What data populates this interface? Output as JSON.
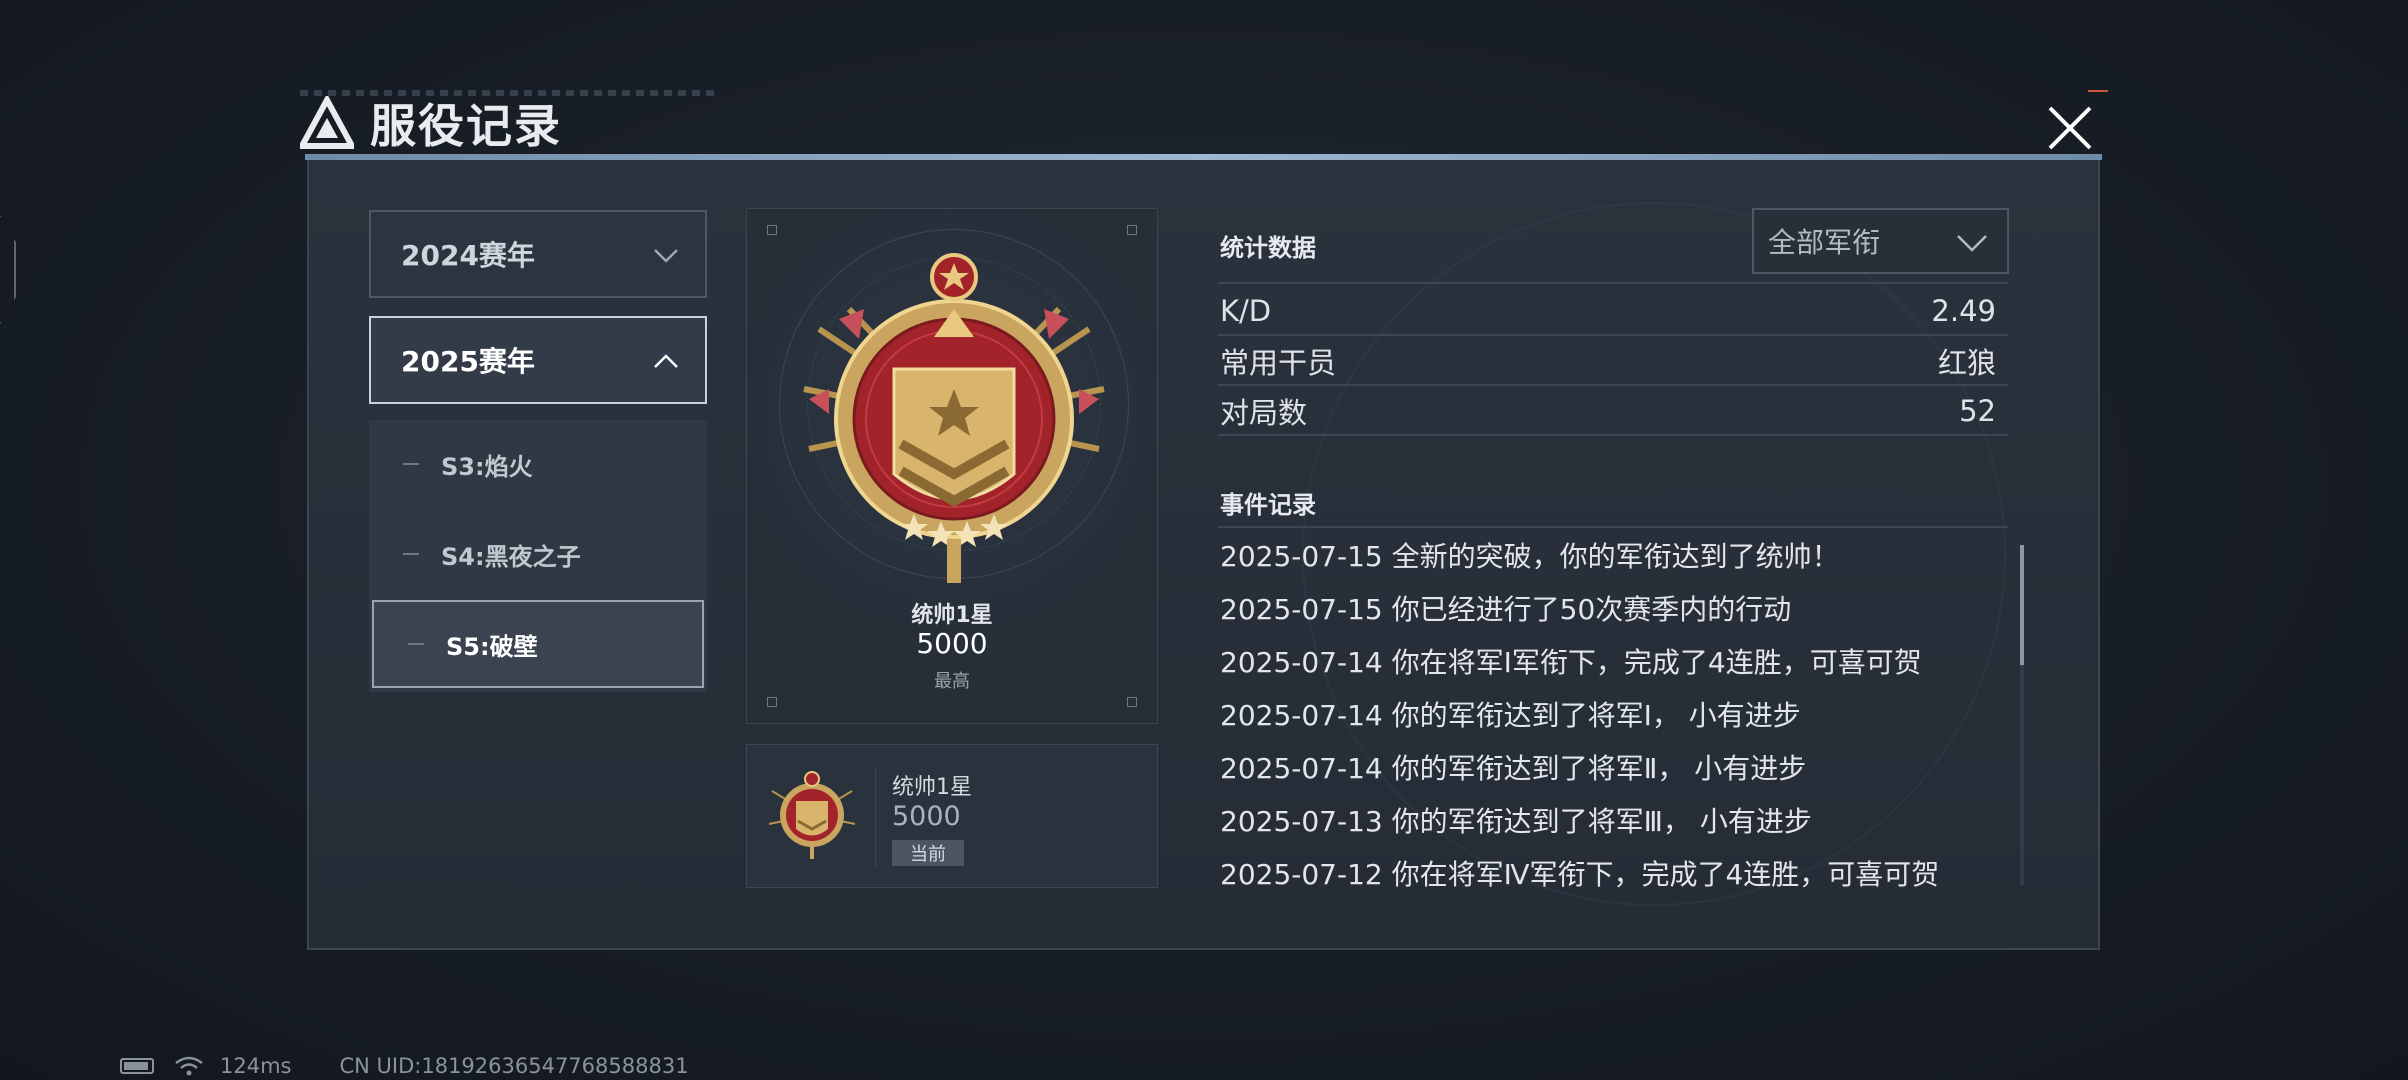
{
  "header": {
    "title": "服役记录"
  },
  "seasons": {
    "year_2024": "2024赛年",
    "year_2025": "2025赛年",
    "items": [
      "S3:焰火",
      "S4:黑夜之子",
      "S5:破壁"
    ],
    "selected_item": "S5:破壁"
  },
  "highest_rank": {
    "name": "统帅1星",
    "score": "5000",
    "tag": "最高"
  },
  "current_rank": {
    "name": "统帅1星",
    "score": "5000",
    "tag": "当前"
  },
  "stats": {
    "title": "统计数据",
    "filter": {
      "selected": "全部军衔"
    },
    "rows": [
      {
        "label": "K/D",
        "value": "2.49"
      },
      {
        "label": "常用干员",
        "value": "红狼"
      },
      {
        "label": "对局数",
        "value": "52"
      }
    ]
  },
  "events": {
    "title": "事件记录",
    "items": [
      "2025-07-15 全新的突破，你的军衔达到了统帅！",
      "2025-07-15 你已经进行了50次赛季内的行动",
      "2025-07-14 你在将军Ⅰ军衔下，完成了4连胜，可喜可贺",
      "2025-07-14 你的军衔达到了将军Ⅰ， 小有进步",
      "2025-07-14 你的军衔达到了将军Ⅱ， 小有进步",
      "2025-07-13 你的军衔达到了将军Ⅲ， 小有进步",
      "2025-07-12 你在将军Ⅳ军衔下，完成了4连胜，可喜可贺"
    ],
    "scroll_fraction": 0.0
  },
  "status_bar": {
    "ping": "124ms",
    "uid": "CN UID:18192636547768588831"
  },
  "colors": {
    "accent_red": "#b3262b",
    "gold": "#d9b36a",
    "panel": "#262e38"
  },
  "icons": [
    "logo-triangle-icon",
    "close-icon",
    "chevron-down-icon",
    "chevron-up-icon",
    "battery-icon",
    "wifi-icon"
  ]
}
